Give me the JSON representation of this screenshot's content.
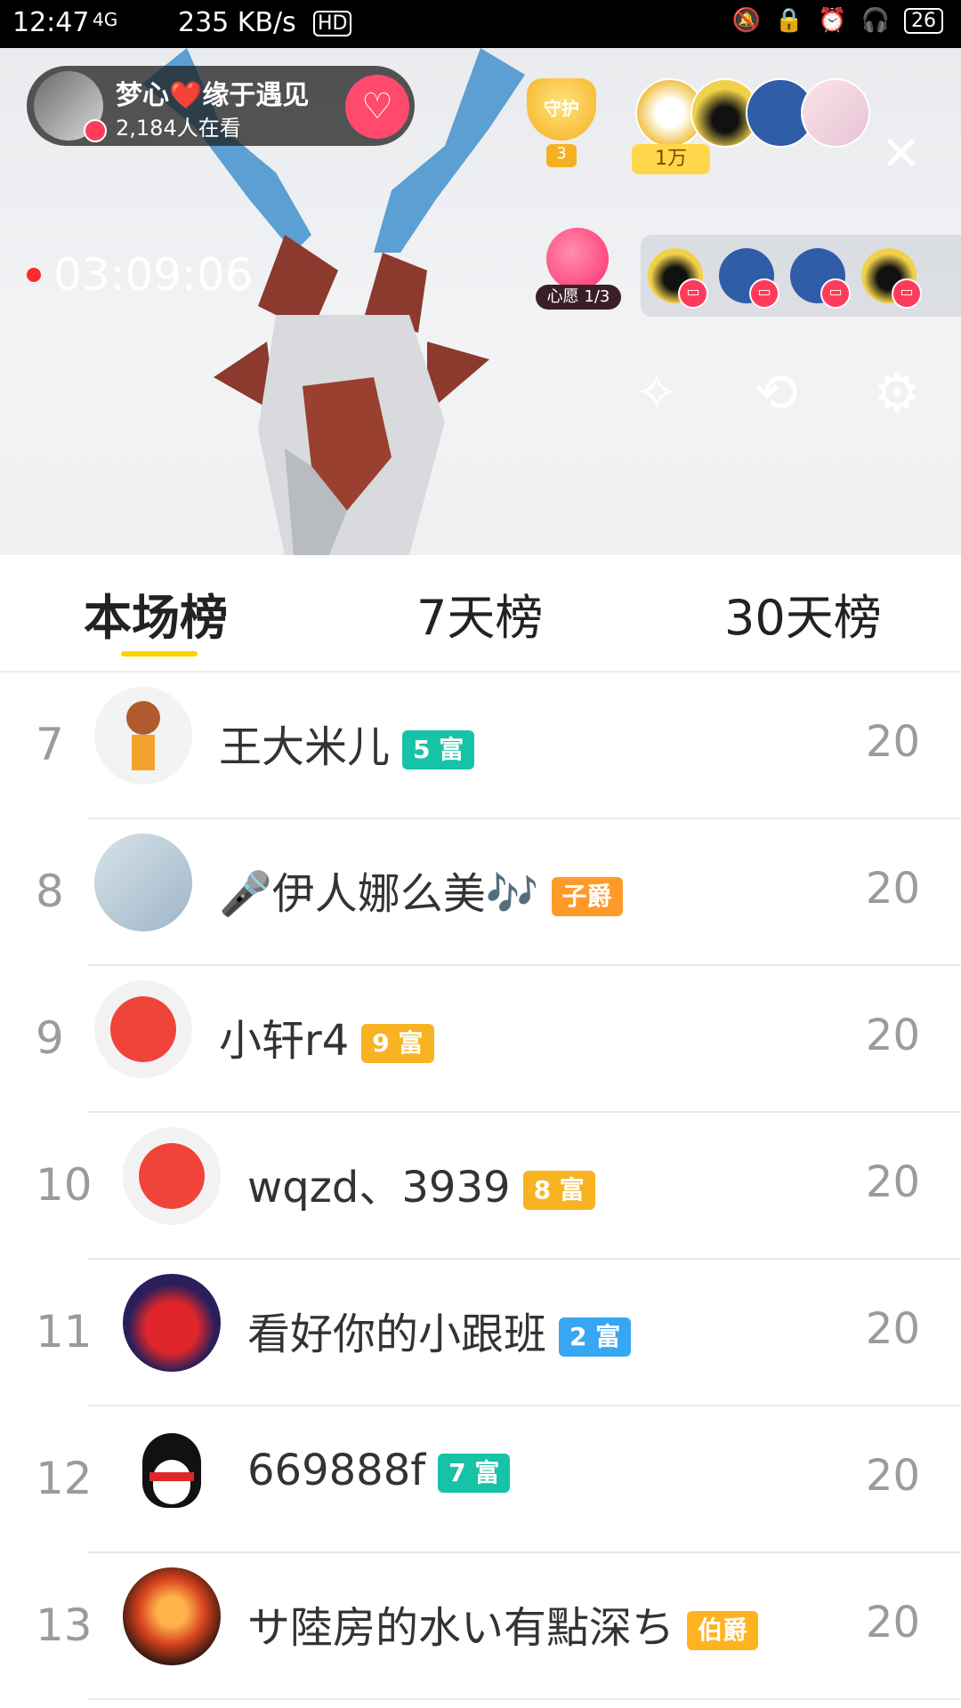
{
  "status_bar": {
    "time": "12:47",
    "network": "4G",
    "speed": "235 KB/s",
    "hd": "HD",
    "battery": "26"
  },
  "stream": {
    "host_name": "梦心❤️缘于遇见",
    "viewer_count": "2,184人在看",
    "guard_label": "守护",
    "guard_count": "3",
    "rich_label": "1万",
    "timer": "03:09:06",
    "wish_label": "心愿 1/3"
  },
  "tabs": [
    {
      "label": "本场榜"
    },
    {
      "label": "7天榜"
    },
    {
      "label": "30天榜"
    }
  ],
  "ranking": [
    {
      "rank": "7",
      "name": "王大米儿",
      "badge": "5 富",
      "badge_color": "#17c3a6",
      "score": "20"
    },
    {
      "rank": "8",
      "name": "🎤伊人娜么美🎶",
      "badge": "子爵",
      "badge_color": "#ff9a2a",
      "score": "20"
    },
    {
      "rank": "9",
      "name": "小轩r4",
      "badge": "9 富",
      "badge_color": "#f7b322",
      "score": "20"
    },
    {
      "rank": "10",
      "name": "wqzd、3939",
      "badge": "8 富",
      "badge_color": "#f7b322",
      "score": "20"
    },
    {
      "rank": "11",
      "name": "看好你的小跟班",
      "badge": "2 富",
      "badge_color": "#38a6f3",
      "score": "20"
    },
    {
      "rank": "12",
      "name": "669888f",
      "badge": "7 富",
      "badge_color": "#17c3a6",
      "score": "20"
    },
    {
      "rank": "13",
      "name": "サ陸房的水い有點深ち",
      "badge": "伯爵",
      "badge_color": "#ffb321",
      "score": "20"
    }
  ]
}
